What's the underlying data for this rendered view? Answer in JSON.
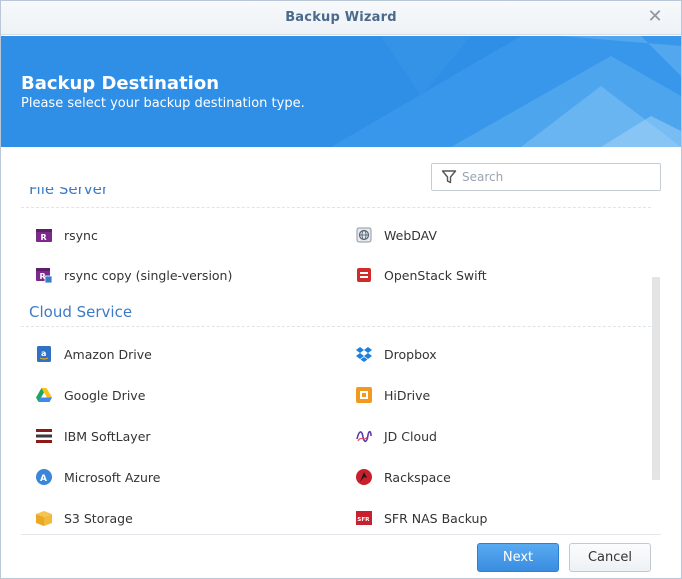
{
  "window": {
    "title": "Backup Wizard"
  },
  "banner": {
    "heading": "Backup Destination",
    "subtitle": "Please select your backup destination type."
  },
  "search": {
    "placeholder": "Search",
    "value": ""
  },
  "sections": {
    "file_server": {
      "label": "File Server",
      "items": [
        {
          "label": "rsync",
          "icon": "rsync-icon"
        },
        {
          "label": "WebDAV",
          "icon": "webdav-icon"
        },
        {
          "label": "rsync copy (single-version)",
          "icon": "rsync-copy-icon"
        },
        {
          "label": "OpenStack Swift",
          "icon": "openstack-icon"
        }
      ]
    },
    "cloud_service": {
      "label": "Cloud Service",
      "items": [
        {
          "label": "Amazon Drive",
          "icon": "amazon-drive-icon"
        },
        {
          "label": "Dropbox",
          "icon": "dropbox-icon"
        },
        {
          "label": "Google Drive",
          "icon": "google-drive-icon"
        },
        {
          "label": "HiDrive",
          "icon": "hidrive-icon"
        },
        {
          "label": "IBM SoftLayer",
          "icon": "ibm-softlayer-icon"
        },
        {
          "label": "JD Cloud",
          "icon": "jd-cloud-icon"
        },
        {
          "label": "Microsoft Azure",
          "icon": "azure-icon"
        },
        {
          "label": "Rackspace",
          "icon": "rackspace-icon"
        },
        {
          "label": "S3 Storage",
          "icon": "s3-storage-icon"
        },
        {
          "label": "SFR NAS Backup",
          "icon": "sfr-icon"
        }
      ]
    }
  },
  "buttons": {
    "next": "Next",
    "cancel": "Cancel"
  },
  "colors": {
    "accent": "#2f8ee6",
    "section_heading": "#3d7bc6",
    "title": "#4a6a8c"
  }
}
